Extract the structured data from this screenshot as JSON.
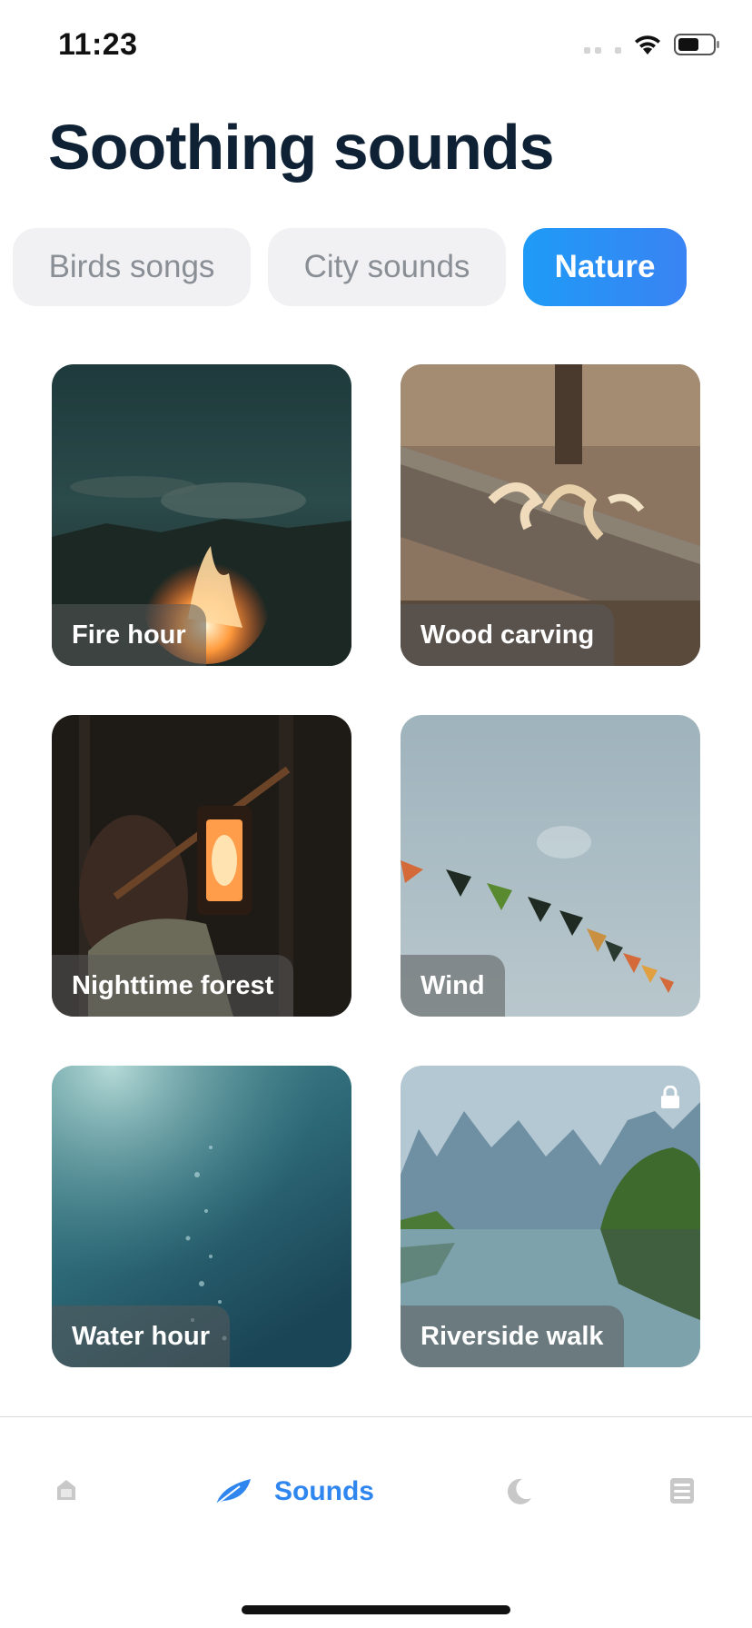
{
  "status_bar": {
    "time": "11:23"
  },
  "page": {
    "title": "Soothing sounds"
  },
  "chips": [
    {
      "label": "Birds songs",
      "selected": false
    },
    {
      "label": "City sounds",
      "selected": false
    },
    {
      "label": "Nature",
      "selected": true
    }
  ],
  "cards": [
    {
      "label": "Fire hour",
      "locked": false
    },
    {
      "label": "Wood carving",
      "locked": false
    },
    {
      "label": "Nighttime forest",
      "locked": false
    },
    {
      "label": "Wind",
      "locked": false
    },
    {
      "label": "Water hour",
      "locked": false
    },
    {
      "label": "Riverside walk",
      "locked": true
    }
  ],
  "tab_bar": {
    "items": [
      {
        "icon": "home-icon",
        "label": "",
        "active": false
      },
      {
        "icon": "feather-icon",
        "label": "Sounds",
        "active": true
      },
      {
        "icon": "moon-icon",
        "label": "",
        "active": false
      },
      {
        "icon": "journal-icon",
        "label": "",
        "active": false
      }
    ]
  },
  "colors": {
    "accent": "#2f86ef",
    "title": "#0f2235",
    "chip_bg": "#f1f1f3",
    "inactive_icon": "#c8c8c8"
  }
}
